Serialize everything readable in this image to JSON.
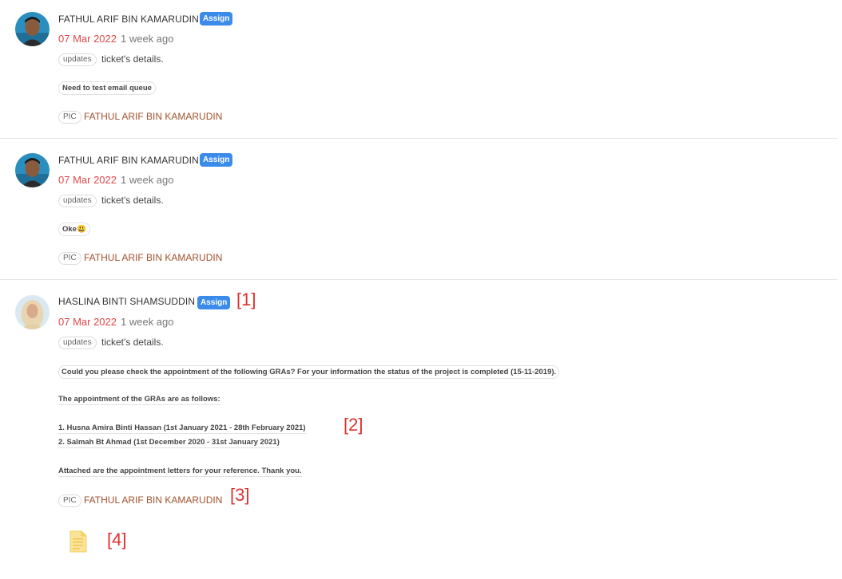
{
  "entries": [
    {
      "author": "FATHUL ARIF BIN KAMARUDIN",
      "badge": "Assign",
      "date": "07 Mar 2022",
      "ago": "1 week ago",
      "action_tag": "updates",
      "action_text": "ticket's details.",
      "messages": [
        "Need to test email queue"
      ],
      "pic_label": "PIC",
      "pic_name": "FATHUL ARIF BIN KAMARUDIN"
    },
    {
      "author": "FATHUL ARIF BIN KAMARUDIN",
      "badge": "Assign",
      "date": "07 Mar 2022",
      "ago": "1 week ago",
      "action_tag": "updates",
      "action_text": "ticket's details.",
      "messages": [
        "Oke😃"
      ],
      "pic_label": "PIC",
      "pic_name": "FATHUL ARIF BIN KAMARUDIN"
    },
    {
      "author": "HASLINA BINTI SHAMSUDDIN",
      "badge": "Assign",
      "date": "07 Mar 2022",
      "ago": "1 week ago",
      "action_tag": "updates",
      "action_text": "ticket's details.",
      "messages": [
        "Could you please check the appointment of the following GRAs? For your information the status of the project is completed (15-11-2019).",
        "The appointment of the GRAs are as follows:",
        "1. Husna Amira Binti Hassan (1st January 2021 - 28th February 2021)",
        "2. Salmah Bt Ahmad (1st December 2020 - 31st January 2021)",
        "Attached are the appointment letters for your reference. Thank you."
      ],
      "pic_label": "PIC",
      "pic_name": "FATHUL ARIF BIN KAMARUDIN",
      "attachment_icon": "document-icon"
    }
  ],
  "markers": [
    "[1]",
    "[2]",
    "[3]",
    "[4]"
  ],
  "colors": {
    "badge": "#3b8beb",
    "date": "#e04848",
    "pic_name": "#a0522d",
    "marker": "#e03030"
  }
}
